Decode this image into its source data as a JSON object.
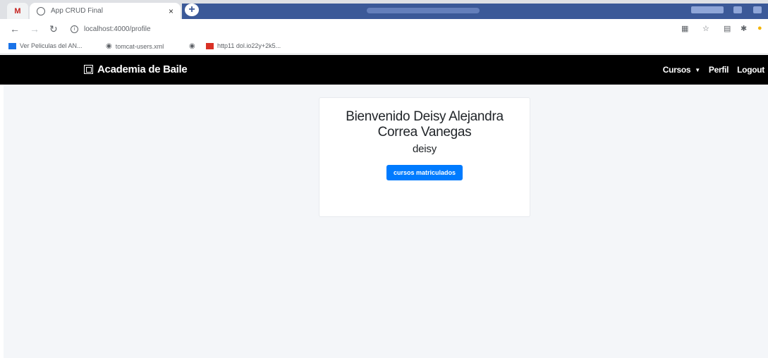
{
  "browser": {
    "tab_title": "App CRUD Final",
    "tab_close": "×",
    "pinned_tab": "M",
    "new_tab": "+",
    "url": "localhost:4000/profile",
    "bookmarks": [
      {
        "label": "Ver Peliculas del AN..."
      },
      {
        "label": "tomcat-users.xml"
      },
      {
        "label": ""
      },
      {
        "label": "http11 dol.io22y+2k5..."
      }
    ]
  },
  "navbar": {
    "brand": "Academia de Baile",
    "cursos": "Cursos",
    "perfil": "Perfil",
    "logout": "Logout"
  },
  "profile": {
    "welcome": "Bienvenido Deisy Alejandra Correa Vanegas",
    "username": "deisy",
    "button": "cursos matriculados"
  },
  "colors": {
    "navbar": "#000000",
    "button": "#007bff",
    "page_bg": "#f4f6f9"
  }
}
